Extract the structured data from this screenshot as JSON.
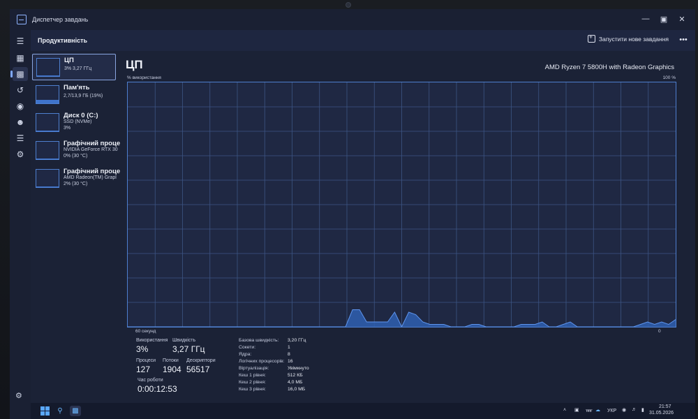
{
  "window": {
    "title": "Диспетчер завдань"
  },
  "header": {
    "title": "Продуктивність",
    "run_new_task": "Запустити нове завдання"
  },
  "sidebar": [
    {
      "name": "ЦП",
      "line1": "3% 3,27 ГГц",
      "line2": "",
      "usage": 0.03,
      "selected": true
    },
    {
      "name": "Пам'ять",
      "line1": "2,7/13,9 ГБ (19%)",
      "line2": "",
      "usage": 0.19,
      "selected": false
    },
    {
      "name": "Диск 0 (C:)",
      "line1": "SSD (NVMe)",
      "line2": "3%",
      "usage": 0.03,
      "selected": false
    },
    {
      "name": "Графічний проце",
      "line1": "NVIDIA GeForce RTX 30",
      "line2": "0% (30 °C)",
      "usage": 0.0,
      "selected": false
    },
    {
      "name": "Графічний проце",
      "line1": "AMD Radeon(TM) Grapl",
      "line2": "2% (30 °C)",
      "usage": 0.02,
      "selected": false
    }
  ],
  "main": {
    "title": "ЦП",
    "model": "AMD Ryzen 7 5800H with Radeon Graphics",
    "y_label": "% використання",
    "y_max_label": "100 %",
    "x_left_label": "60 секунд",
    "x_right_label": "0"
  },
  "chart_data": {
    "type": "area",
    "x_range_seconds": [
      60,
      0
    ],
    "ylim": [
      0,
      100
    ],
    "grid": true,
    "values": [
      0,
      0,
      0,
      0,
      0,
      0,
      0,
      0,
      0,
      0,
      0,
      0,
      0,
      0,
      0,
      0,
      0,
      0,
      0,
      0,
      0,
      0,
      0,
      0,
      0,
      0,
      0,
      0,
      0,
      0,
      0,
      0,
      7,
      7,
      2,
      2,
      2,
      2,
      6,
      0,
      6,
      5,
      2,
      1,
      1,
      1,
      0,
      0,
      0,
      1,
      1,
      0,
      0,
      0,
      0,
      0,
      1,
      1,
      1,
      2,
      0,
      0,
      1,
      2,
      0,
      0,
      0,
      0,
      0,
      0,
      0,
      0,
      0,
      1,
      2,
      1,
      2,
      1,
      3
    ]
  },
  "stats": {
    "usage_label": "Використання",
    "usage_value": "3%",
    "speed_label": "Швидкість",
    "speed_value": "3,27 ГГц",
    "processes_label": "Процеси",
    "processes_value": "127",
    "threads_label": "Потоки",
    "threads_value": "1904",
    "handles_label": "Дескриптори",
    "handles_value": "56517",
    "uptime_label": "Час роботи",
    "uptime_value": "0:00:12:53"
  },
  "specs": [
    {
      "key": "Базова швидкість:",
      "value": "3,20 ГГц"
    },
    {
      "key": "Сокети:",
      "value": "1"
    },
    {
      "key": "Ядра:",
      "value": "8"
    },
    {
      "key": "Логічних процесорів:",
      "value": "16"
    },
    {
      "key": "Віртуалізація:",
      "value": "Увімкнуто"
    },
    {
      "key": "Кеш 1 рівня:",
      "value": "512 КБ"
    },
    {
      "key": "Кеш 2 рівня:",
      "value": "4,0 МБ"
    },
    {
      "key": "Кеш 3 рівня:",
      "value": "16,0 МБ"
    }
  ],
  "taskbar": {
    "language": "УКР",
    "time": "21:57",
    "date": "31.05.2026"
  },
  "colors": {
    "accent": "#3f74cc",
    "graph_border": "#4e7fcf",
    "graph_bg": "#1f2843"
  }
}
